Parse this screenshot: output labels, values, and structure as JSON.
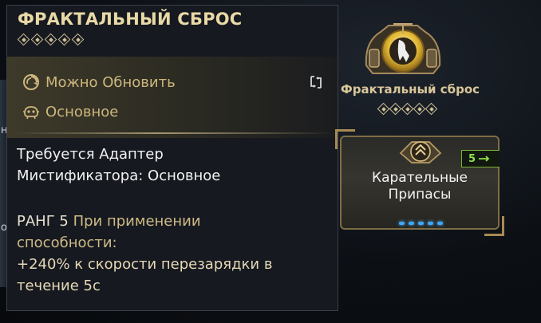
{
  "tooltip": {
    "title": "ФРАКТАЛЬНЫЙ СБРОС",
    "stars": 5,
    "upgrade_label": "Можно Обновить",
    "type_label": "Основное",
    "requirement_line1": "Требуется Адаптер",
    "requirement_line2": "Мистификатора: Основное",
    "rank_label": "РАНГ 5",
    "rank_condition_a": "При применении",
    "rank_condition_b": "способности:",
    "rank_effect_line1": "+240% к скорости перезарядки в",
    "rank_effect_line2": "течение 5с"
  },
  "arcane": {
    "name": "Фрактальный сброс",
    "stars": 5
  },
  "mod": {
    "name_line1": "Карательные",
    "name_line2": "Припасы",
    "cost": "5",
    "rank_filled": 5
  },
  "background": {
    "left_glyph_1": "н",
    "left_glyph_2": "о"
  },
  "colors": {
    "title": "#e9d9a6",
    "label_gold": "#cdb77d",
    "mod_cost_green": "#8ee04d",
    "rank_dots_blue": "#3fa8ff"
  },
  "icons": [
    "cycle-icon",
    "base-type-icon",
    "swap-icon",
    "arcane-emblem-icon",
    "mod-emblem-icon",
    "drain-icon"
  ]
}
